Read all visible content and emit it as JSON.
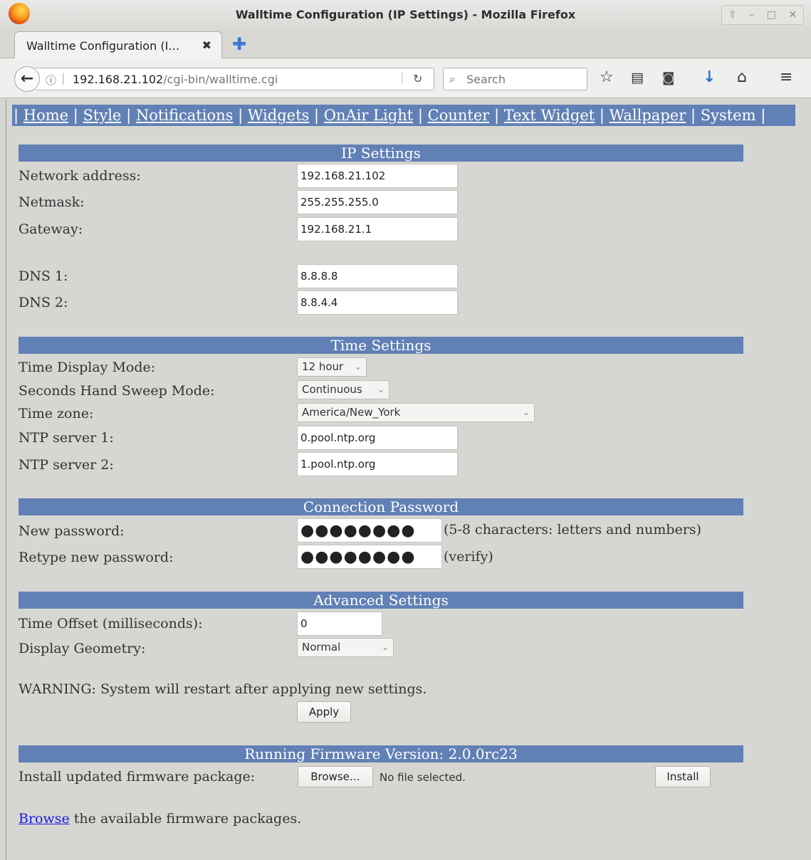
{
  "window": {
    "title": "Walltime Configuration (IP Settings) - Mozilla Firefox",
    "controls": [
      "⇧",
      "–",
      "□",
      "✕"
    ]
  },
  "tab": {
    "label": "Walltime Configuration (I…",
    "close": "✖",
    "new": "✚"
  },
  "navbar": {
    "url_host": "192.168.21.102",
    "url_path": "/cgi-bin/walltime.cgi",
    "search_placeholder": "Search",
    "icons": [
      "star-icon",
      "reading-list-icon",
      "pocket-icon",
      "download-icon",
      "home-icon",
      "menu-icon"
    ]
  },
  "nav_links": [
    "Home",
    "Style",
    "Notifications",
    "Widgets",
    "OnAir Light",
    "Counter",
    "Text Widget",
    "Wallpaper",
    "System"
  ],
  "ip": {
    "header": "IP Settings",
    "network_label": "Network address:",
    "network_value": "192.168.21.102",
    "netmask_label": "Netmask:",
    "netmask_value": "255.255.255.0",
    "gateway_label": "Gateway:",
    "gateway_value": "192.168.21.1",
    "dns1_label": "DNS 1:",
    "dns1_value": "8.8.8.8",
    "dns2_label": "DNS 2:",
    "dns2_value": "8.8.4.4"
  },
  "time": {
    "header": "Time Settings",
    "display_mode_label": "Time Display Mode:",
    "display_mode_value": "12 hour",
    "sweep_label": "Seconds Hand Sweep Mode:",
    "sweep_value": "Continuous",
    "tz_label": "Time zone:",
    "tz_value": "America/New_York",
    "ntp1_label": "NTP server 1:",
    "ntp1_value": "0.pool.ntp.org",
    "ntp2_label": "NTP server 2:",
    "ntp2_value": "1.pool.ntp.org"
  },
  "password": {
    "header": "Connection Password",
    "new_label": "New password:",
    "new_value": "●●●●●●●●",
    "new_hint": "(5-8 characters: letters and numbers)",
    "retype_label": "Retype new password:",
    "retype_value": "●●●●●●●●",
    "retype_hint": "(verify)"
  },
  "advanced": {
    "header": "Advanced Settings",
    "offset_label": "Time Offset (milliseconds):",
    "offset_value": "0",
    "geometry_label": "Display Geometry:",
    "geometry_value": "Normal",
    "warning": "WARNING: System will restart after applying new settings.",
    "apply": "Apply"
  },
  "firmware": {
    "header": "Running Firmware Version: 2.0.0rc23",
    "install_label": "Install updated firmware package:",
    "browse_button": "Browse…",
    "no_file": "No file selected.",
    "install_button": "Install",
    "browse_link": "Browse",
    "browse_suffix": " the available firmware packages."
  }
}
